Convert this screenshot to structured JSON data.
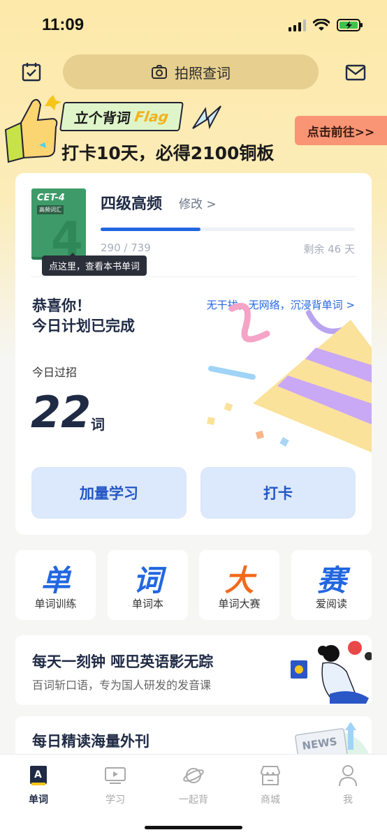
{
  "status_bar": {
    "time": "11:09"
  },
  "top_bar": {
    "photo_search_label": "拍照查词"
  },
  "banner": {
    "flag_prefix": "立个背词",
    "flag_word": "Flag",
    "subtitle": "打卡10天，必得2100铜板",
    "cta": "点击前往>>"
  },
  "book": {
    "cover_title": "CET-4",
    "cover_sub": "高频词汇",
    "cover_number": "4",
    "title": "四级高频",
    "edit_label": "修改 >",
    "progress_text": "290 / 739",
    "progress_learned": 290,
    "progress_total": 739,
    "remaining": "剩余 46 天",
    "tooltip": "点这里，查看本书单词"
  },
  "today": {
    "congrats_line1": "恭喜你！",
    "congrats_line2": "今日计划已完成",
    "immersive_link": "无干扰，无网络，沉浸背单词 >",
    "label": "今日过招",
    "count": "22",
    "unit": "词"
  },
  "actions": {
    "add_study": "加量学习",
    "checkin": "打卡"
  },
  "tiles": [
    {
      "glyph": "单",
      "label": "单词训练",
      "color": "#2267e0"
    },
    {
      "glyph": "词",
      "label": "单词本",
      "color": "#2267e0"
    },
    {
      "glyph": "大",
      "label": "单词大赛",
      "color": "#f26a1b"
    },
    {
      "glyph": "赛",
      "label": "爱阅读",
      "color": "#2267e0"
    }
  ],
  "promos": [
    {
      "title": "每天一刻钟 哑巴英语影无踪",
      "subtitle": "百词斩口语，专为国人研发的发音课"
    },
    {
      "title": "每日精读海量外刊",
      "badge": "NEWS"
    }
  ],
  "tabbar": {
    "tabs": [
      {
        "label": "单词",
        "active": true
      },
      {
        "label": "学习",
        "active": false
      },
      {
        "label": "一起背",
        "active": false
      },
      {
        "label": "商城",
        "active": false
      },
      {
        "label": "我",
        "active": false
      }
    ]
  }
}
